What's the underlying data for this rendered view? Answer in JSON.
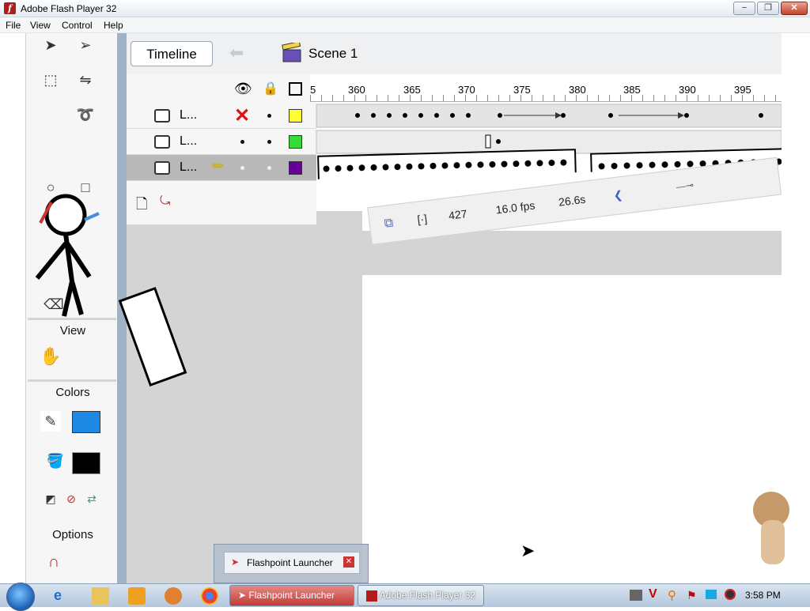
{
  "window": {
    "title": "Adobe Flash Player 32",
    "controls": {
      "minimize": "−",
      "maximize": "❐",
      "close": "✕"
    }
  },
  "menu": [
    "File",
    "View",
    "Control",
    "Help"
  ],
  "flash": {
    "timeline_button": "Timeline",
    "scene_label": "Scene 1",
    "layers": [
      {
        "name": "L...",
        "swatch_color": "#ffff33"
      },
      {
        "name": "L...",
        "swatch_color": "#33dd33"
      },
      {
        "name": "L...",
        "swatch_color": "#660099"
      }
    ],
    "ruler_start": "5",
    "ruler_ticks": [
      "360",
      "365",
      "370",
      "375",
      "380",
      "385",
      "390",
      "395"
    ],
    "status": {
      "frame": "427",
      "fps": "16.0 fps",
      "time": "26.6s"
    },
    "tool_sections": {
      "view": "View",
      "colors": "Colors",
      "options": "Options"
    },
    "stroke_color": "#000000",
    "fill_color": "#1e88e5"
  },
  "taskbar": {
    "tasks": [
      {
        "label": "Flashpoint Launcher",
        "active": true
      },
      {
        "label": "Adobe Flash Player 32",
        "active": false
      }
    ],
    "popup_label": "Flashpoint Launcher",
    "clock": "3:58 PM"
  }
}
